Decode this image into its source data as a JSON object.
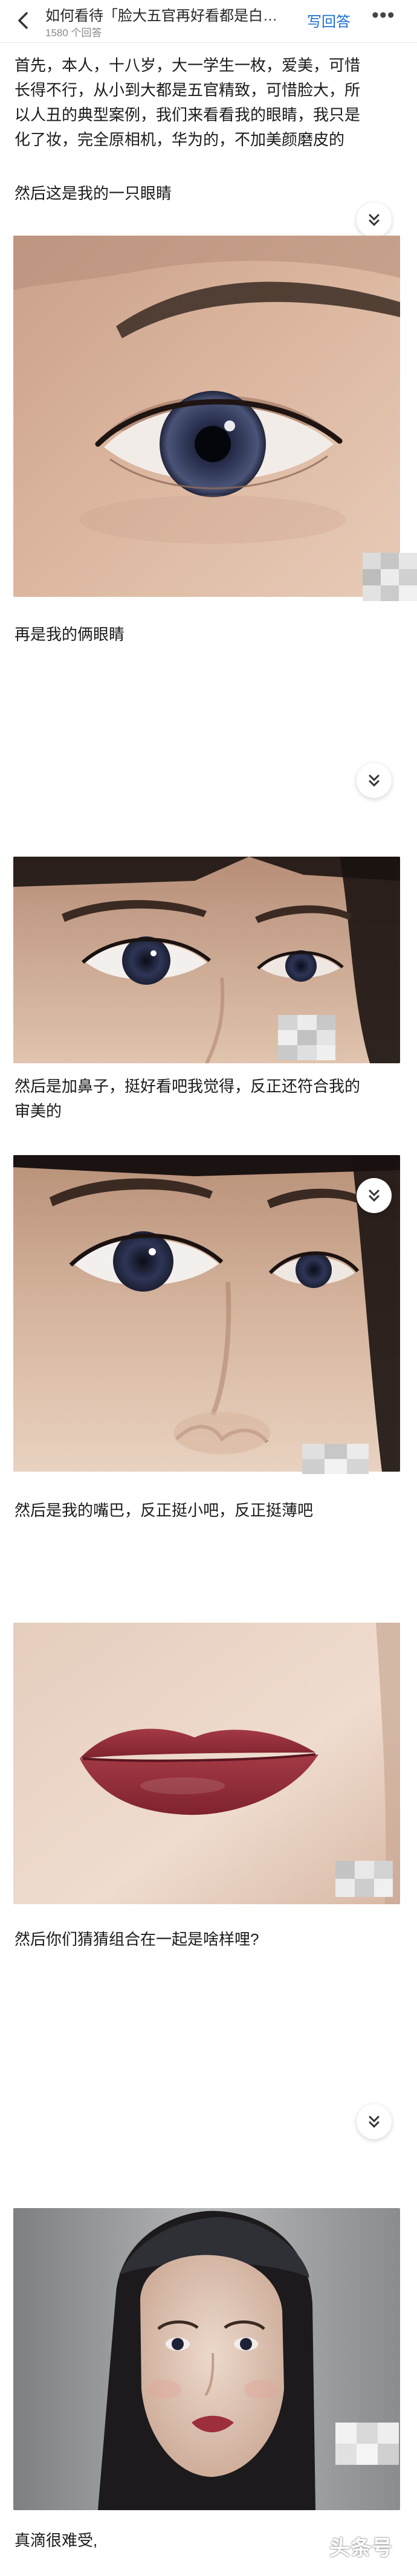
{
  "header": {
    "title": "如何看待「脸大五官再好看都是白…",
    "answer_count": "1580 个回答",
    "write_answer": "写回答",
    "more_icon": "more-dots-icon"
  },
  "article": {
    "intro": [
      "首先，本人，十八岁，大一学生一枚，爱美，可惜",
      "长得不行，从小到大都是五官精致，可惜脸大，所",
      "以人丑的典型案例，我们来看看我的眼睛，我只是",
      "化了妆，完全原相机，华为的，不加美颜磨皮的"
    ],
    "p_one_eye": "然后这是我的一只眼睛",
    "p_two_eyes": "再是我的俩眼睛",
    "p_nose": [
      "然后是加鼻子，挺好看吧我觉得，反正还符合我的",
      "审美的"
    ],
    "p_mouth": "然后是我的嘴巴，反正挺小吧，反正挺薄吧",
    "p_guess": "然后你们猜猜组合在一起是啥样哩?",
    "p_end": "真滴很难受,"
  },
  "watermark": "头条号"
}
